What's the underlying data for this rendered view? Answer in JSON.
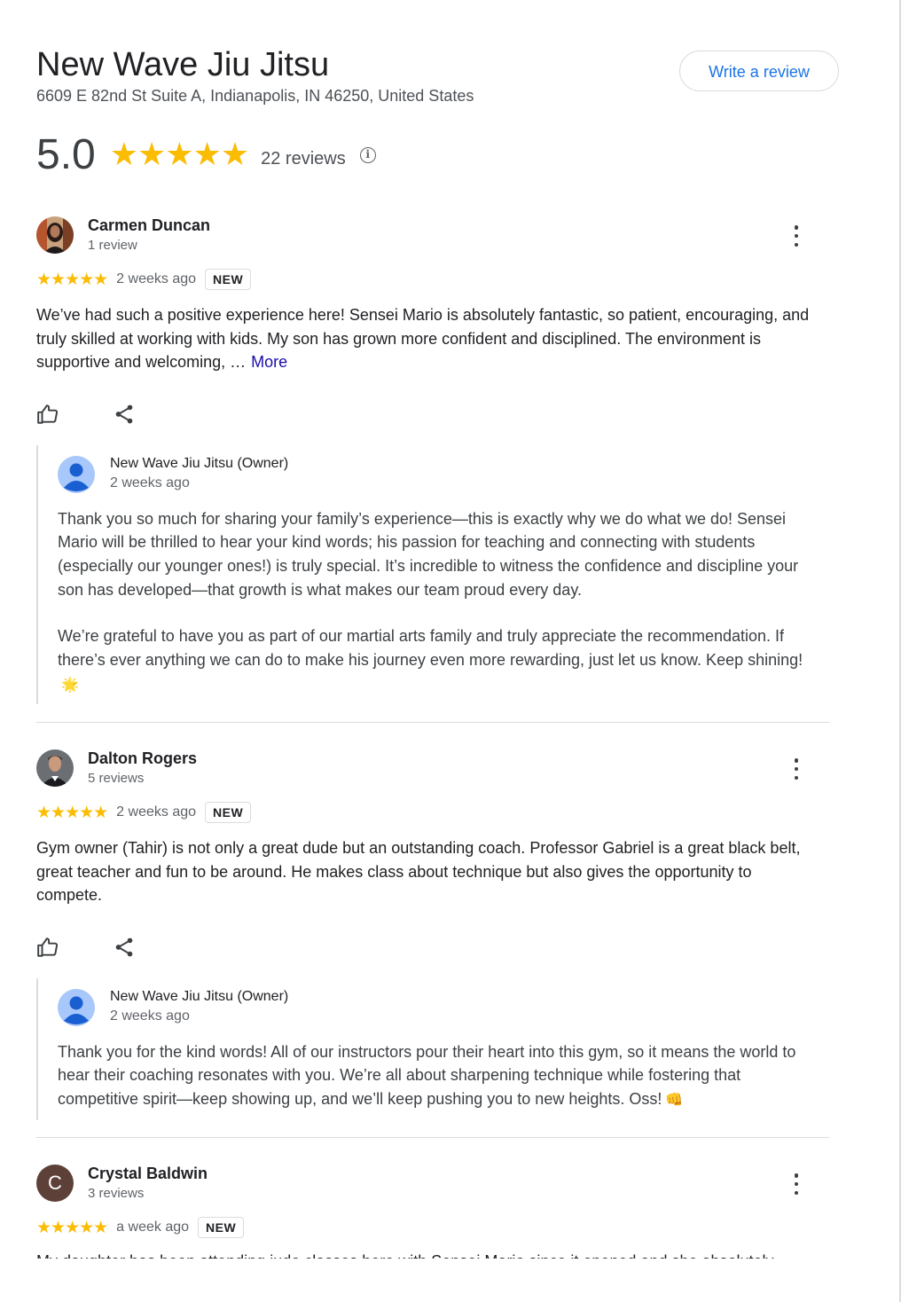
{
  "place": {
    "name": "New Wave Jiu Jitsu",
    "address": "6609 E 82nd St Suite A, Indianapolis, IN 46250, United States",
    "write_review_label": "Write a review"
  },
  "summary": {
    "rating": "5.0",
    "stars": "★★★★★",
    "review_count": "22 reviews",
    "info_icon": "info-icon"
  },
  "colors": {
    "star": "#fbbc04",
    "link": "#1a73e8",
    "more_link": "#1a0dab",
    "divider": "#dadce0",
    "owner_avatar": "#a8c7fa"
  },
  "reviews": [
    {
      "name": "Carmen Duncan",
      "meta": "1 review",
      "stars": "★★★★★",
      "when": "2 weeks ago",
      "badge": "NEW",
      "text": "We’ve had such a positive experience here! Sensei Mario is absolutely fantastic, so patient, encouraging, and truly skilled at working with kids. My son has grown more confident and disciplined. The environment is supportive and welcoming, …",
      "more_label": "More",
      "owner": {
        "name": "New Wave Jiu Jitsu (Owner)",
        "when": "2 weeks ago",
        "paragraphs": [
          "Thank you so much for sharing your family’s experience—this is exactly why we do what we do! Sensei Mario will be thrilled to hear your kind words; his passion for teaching and connecting with students (especially our younger ones!) is truly special. It’s incredible to witness the confidence and discipline your son has developed—that growth is what makes our team proud every day.",
          "We’re grateful to have you as part of our martial arts family and truly appreciate the recommendation. If there’s ever anything we can do to make his journey even more rewarding, just let us know. Keep shining!"
        ],
        "emoji": "🌟"
      }
    },
    {
      "name": "Dalton Rogers",
      "meta": "5 reviews",
      "stars": "★★★★★",
      "when": "2 weeks ago",
      "badge": "NEW",
      "text": "Gym owner (Tahir) is not only a great dude but an outstanding coach. Professor Gabriel is a great black belt, great teacher and fun to be around. He makes class about technique but also gives the opportunity to compete.",
      "owner": {
        "name": "New Wave Jiu Jitsu (Owner)",
        "when": "2 weeks ago",
        "paragraphs": [
          "Thank you for the kind words! All of our instructors pour their heart into this gym, so it means the world to hear their coaching resonates with you. We’re all about sharpening technique while fostering that competitive spirit—keep showing up, and we’ll keep pushing you to new heights. Oss!"
        ],
        "emoji": "👊"
      }
    },
    {
      "name": "Crystal Baldwin",
      "initial": "C",
      "meta": "3 reviews",
      "stars": "★★★★★",
      "when": "a week ago",
      "badge": "NEW",
      "text_partial": "My daughter has been attending judo classes here with Sensei Mario since it opened and she absolutely"
    }
  ]
}
